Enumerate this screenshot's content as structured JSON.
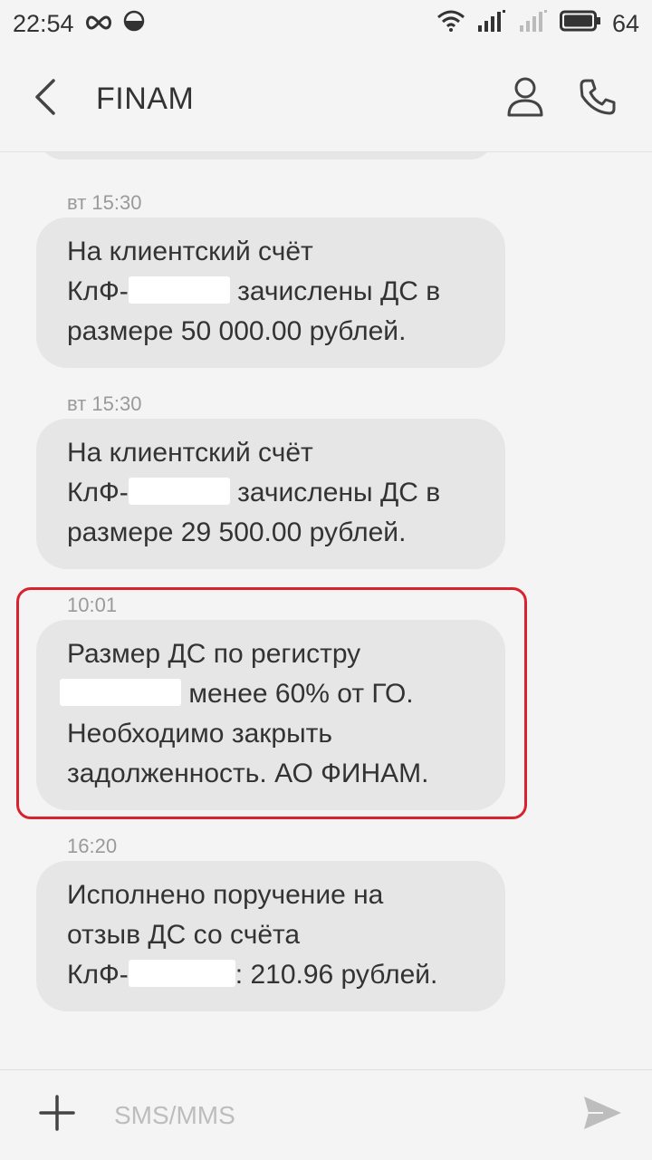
{
  "status_bar": {
    "time": "22:54",
    "battery_level": "64",
    "icons": [
      "infinity-icon",
      "data-saver-icon",
      "wifi-icon",
      "signal-icon",
      "signal-icon-2",
      "battery-icon"
    ]
  },
  "app_bar": {
    "title": "FINAM",
    "icons": [
      "back-arrow-icon",
      "contact-icon",
      "phone-icon"
    ]
  },
  "messages": [
    {
      "time": "вт 15:30",
      "line1": "На клиентский счёт",
      "line2_prefix": "КлФ-",
      "line2_suffix": " зачислены ДС в",
      "line3": "размере 50 000.00 рублей."
    },
    {
      "time": "вт 15:30",
      "line1": "На клиентский счёт",
      "line2_prefix": "КлФ-",
      "line2_suffix": " зачислены ДС в",
      "line3": "размере 29 500.00 рублей."
    },
    {
      "time": "10:01",
      "line1": "Размер ДС по регистру",
      "line2_suffix": " менее 60% от ГО.",
      "line3": "Необходимо закрыть",
      "line4": "задолженность. АО ФИНАМ."
    },
    {
      "time": "16:20",
      "line1": "Исполнено поручение на",
      "line2": "отзыв ДС со счёта",
      "line3_prefix": "КлФ-",
      "line3_suffix": ": 210.96 рублей."
    }
  ],
  "colors": {
    "highlight_border": "#d8232f",
    "bubble": "#e6e6e6",
    "background": "#f4f4f4"
  },
  "composer": {
    "placeholder": "SMS/MMS",
    "icons": [
      "plus-icon",
      "send-icon"
    ]
  }
}
